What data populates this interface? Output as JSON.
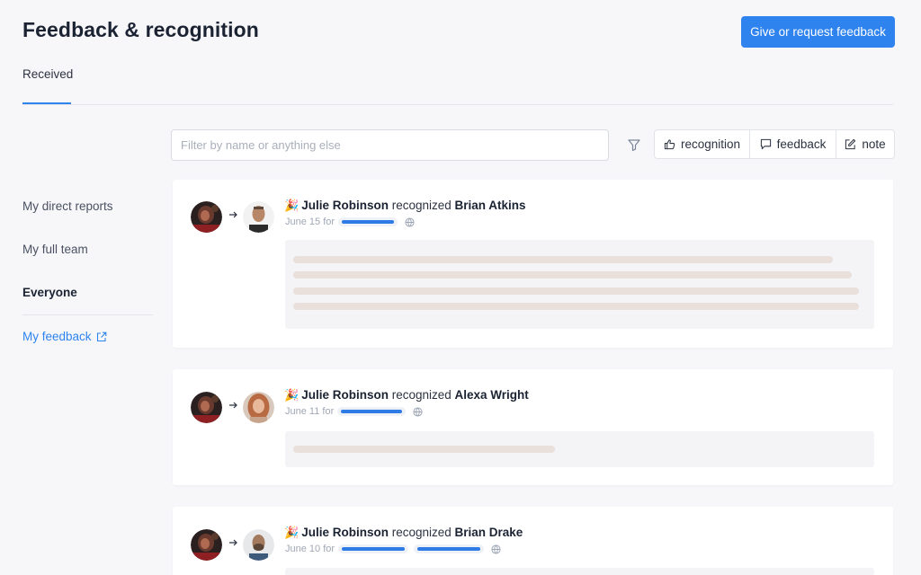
{
  "header": {
    "title": "Feedback & recognition",
    "primary_button": "Give or request feedback"
  },
  "tabs": [
    {
      "label": "Received",
      "active": true
    }
  ],
  "search": {
    "placeholder": "Filter by name or anything else"
  },
  "toolbar": {
    "filter_icon": "filter-icon",
    "buttons": [
      {
        "label": "recognition",
        "icon": "thumbs-up-icon"
      },
      {
        "label": "feedback",
        "icon": "speech-bubble-icon"
      },
      {
        "label": "note",
        "icon": "edit-icon"
      }
    ]
  },
  "sidebar": {
    "items": [
      {
        "label": "My direct reports"
      },
      {
        "label": "My full team"
      },
      {
        "label": "Everyone",
        "active": true
      }
    ],
    "link": {
      "label": "My feedback",
      "icon": "external-link-icon"
    }
  },
  "feed": [
    {
      "giver": "Julie Robinson",
      "verb": "recognized",
      "recipient": "Brian Atkins",
      "date": "June 15",
      "for_label": "for",
      "emoji": "🎉"
    },
    {
      "giver": "Julie Robinson",
      "verb": "recognized",
      "recipient": "Alexa Wright",
      "date": "June 11",
      "for_label": "for",
      "emoji": "🎉"
    },
    {
      "giver": "Julie Robinson",
      "verb": "recognized",
      "recipient": "Brian Drake",
      "date": "June 10",
      "for_label": "for",
      "emoji": "🎉"
    }
  ],
  "colors": {
    "accent": "#2e83ee",
    "background": "#f7f7fa",
    "placeholder_line": "#e9dfdb"
  }
}
